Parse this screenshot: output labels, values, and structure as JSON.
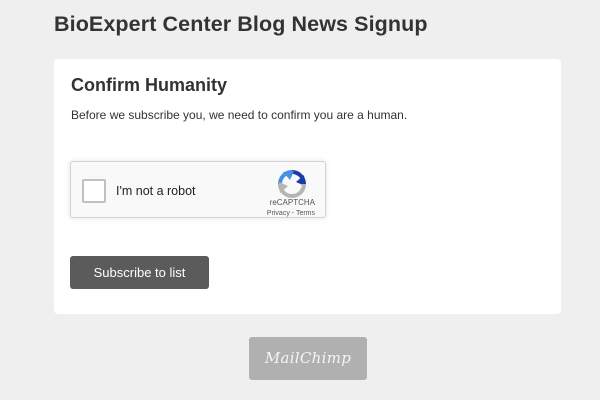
{
  "header": {
    "title": "BioExpert Center Blog News Signup"
  },
  "card": {
    "title": "Confirm Humanity",
    "intro": "Before we subscribe you, we need to confirm you are a human."
  },
  "recaptcha": {
    "checkbox_label": "I'm not a robot",
    "brand": "reCAPTCHA",
    "privacy_link": "Privacy",
    "separator": " - ",
    "terms_link": "Terms",
    "checked": false,
    "logo_icon": "recaptcha-logo-icon",
    "colors": {
      "blue": "#4a90e2",
      "dark_blue": "#1c3aa9",
      "gray": "#b5b5b5"
    }
  },
  "form": {
    "subscribe_label": "Subscribe to list"
  },
  "footer": {
    "badge_text": "MailChimp"
  },
  "theme": {
    "page_background": "#efefef",
    "card_background": "#ffffff",
    "button_background": "#5b5b5b",
    "badge_background": "#b0b0b0"
  }
}
